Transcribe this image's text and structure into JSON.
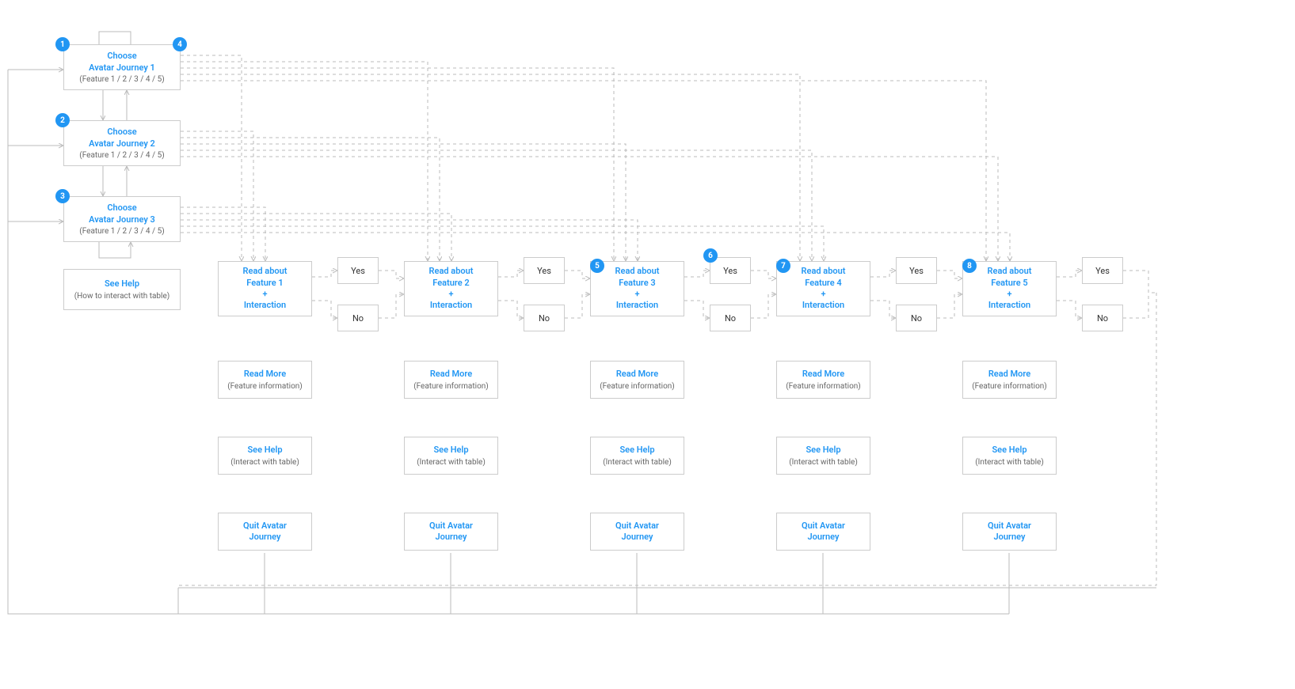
{
  "journeys": [
    {
      "title": "Choose\nAvatar Journey 1",
      "sub": "(Feature 1 / 2 / 3 / 4 / 5)"
    },
    {
      "title": "Choose\nAvatar Journey 2",
      "sub": "(Feature 1 / 2 / 3 / 4 / 5)"
    },
    {
      "title": "Choose\nAvatar Journey 3",
      "sub": "(Feature 1 / 2 / 3 / 4 / 5)"
    }
  ],
  "seeHelpMain": {
    "title": "See Help",
    "sub": "(How to interact with table)"
  },
  "columns": [
    {
      "read": "Read about\nFeature 1\n+\nInteraction",
      "more": "Read More",
      "moreSub": "(Feature information)",
      "help": "See Help",
      "helpSub": "(Interact with table)",
      "quit": "Quit Avatar\nJourney"
    },
    {
      "read": "Read about\nFeature 2\n+\nInteraction",
      "more": "Read More",
      "moreSub": "(Feature information)",
      "help": "See Help",
      "helpSub": "(Interact with table)",
      "quit": "Quit Avatar\nJourney"
    },
    {
      "read": "Read about\nFeature 3\n+\nInteraction",
      "more": "Read More",
      "moreSub": "(Feature information)",
      "help": "See Help",
      "helpSub": "(Interact with table)",
      "quit": "Quit Avatar\nJourney"
    },
    {
      "read": "Read about\nFeature 4\n+\nInteraction",
      "more": "Read More",
      "moreSub": "(Feature information)",
      "help": "See Help",
      "helpSub": "(Interact with table)",
      "quit": "Quit Avatar\nJourney"
    },
    {
      "read": "Read about\nFeature 5\n+\nInteraction",
      "more": "Read More",
      "moreSub": "(Feature information)",
      "help": "See Help",
      "helpSub": "(Interact with table)",
      "quit": "Quit Avatar\nJourney"
    }
  ],
  "yes": "Yes",
  "no": "No",
  "badges": [
    "1",
    "2",
    "3",
    "4",
    "5",
    "6",
    "7",
    "8"
  ]
}
